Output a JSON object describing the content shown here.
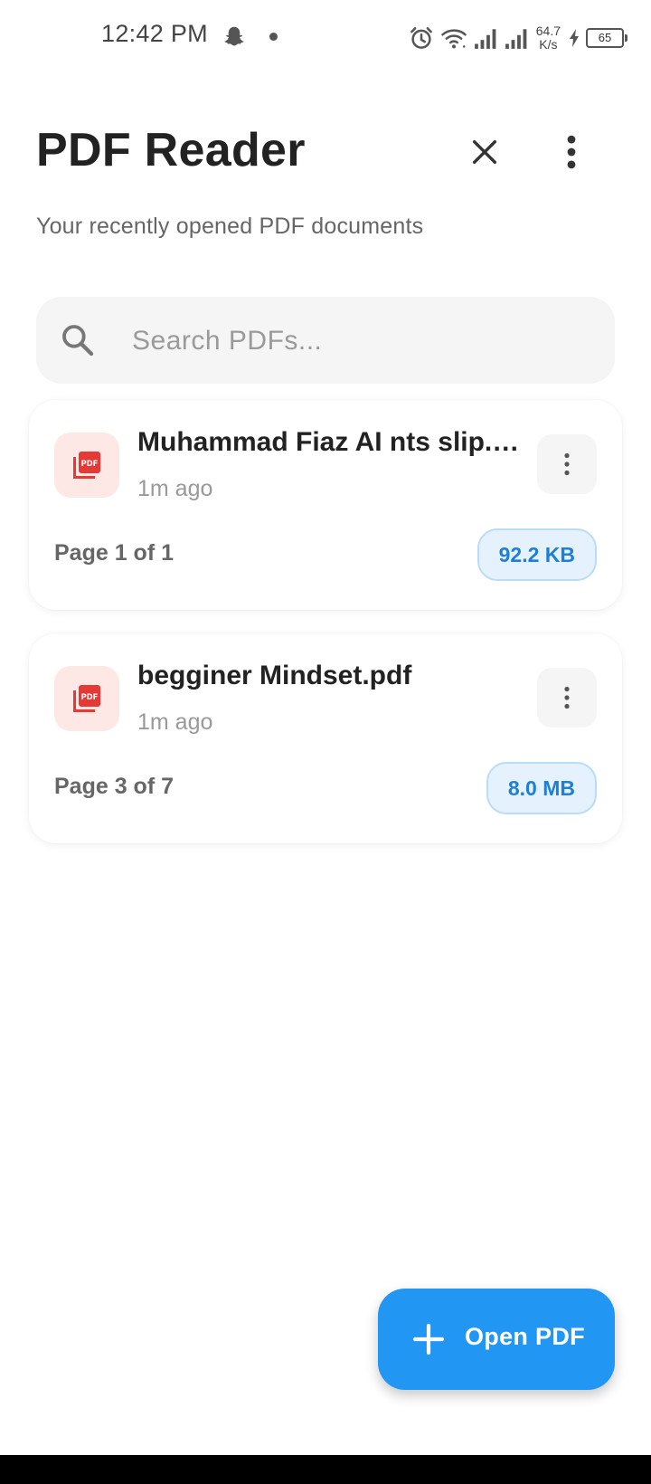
{
  "status_bar": {
    "time": "12:42 PM",
    "net_speed_value": "64.7",
    "net_speed_unit": "K/s",
    "battery_level": "65",
    "icons": [
      "snapchat-icon",
      "dot-indicator",
      "alarm-icon",
      "wifi-icon",
      "signal-icon",
      "signal-icon",
      "charging-icon",
      "battery-icon"
    ]
  },
  "header": {
    "title": "PDF Reader",
    "subtitle": "Your recently opened PDF documents",
    "close_icon": "close-icon",
    "menu_icon": "more-vertical-icon"
  },
  "search": {
    "placeholder": "Search PDFs...",
    "value": ""
  },
  "documents": [
    {
      "name": "Muhammad Fiaz AI nts slip.pdf",
      "time": "1m ago",
      "pages": "Page 1 of 1",
      "size": "92.2 KB"
    },
    {
      "name": "begginer Mindset.pdf",
      "time": "1m ago",
      "pages": "Page 3 of 7",
      "size": "8.0 MB"
    }
  ],
  "fab": {
    "label": "Open PDF",
    "icon": "plus-icon"
  },
  "colors": {
    "accent": "#2196F3",
    "pdf_red": "#E53935",
    "pdf_bg": "#FDE8E6",
    "badge_bg": "#E5F2FD",
    "badge_text": "#1E7FD6"
  }
}
